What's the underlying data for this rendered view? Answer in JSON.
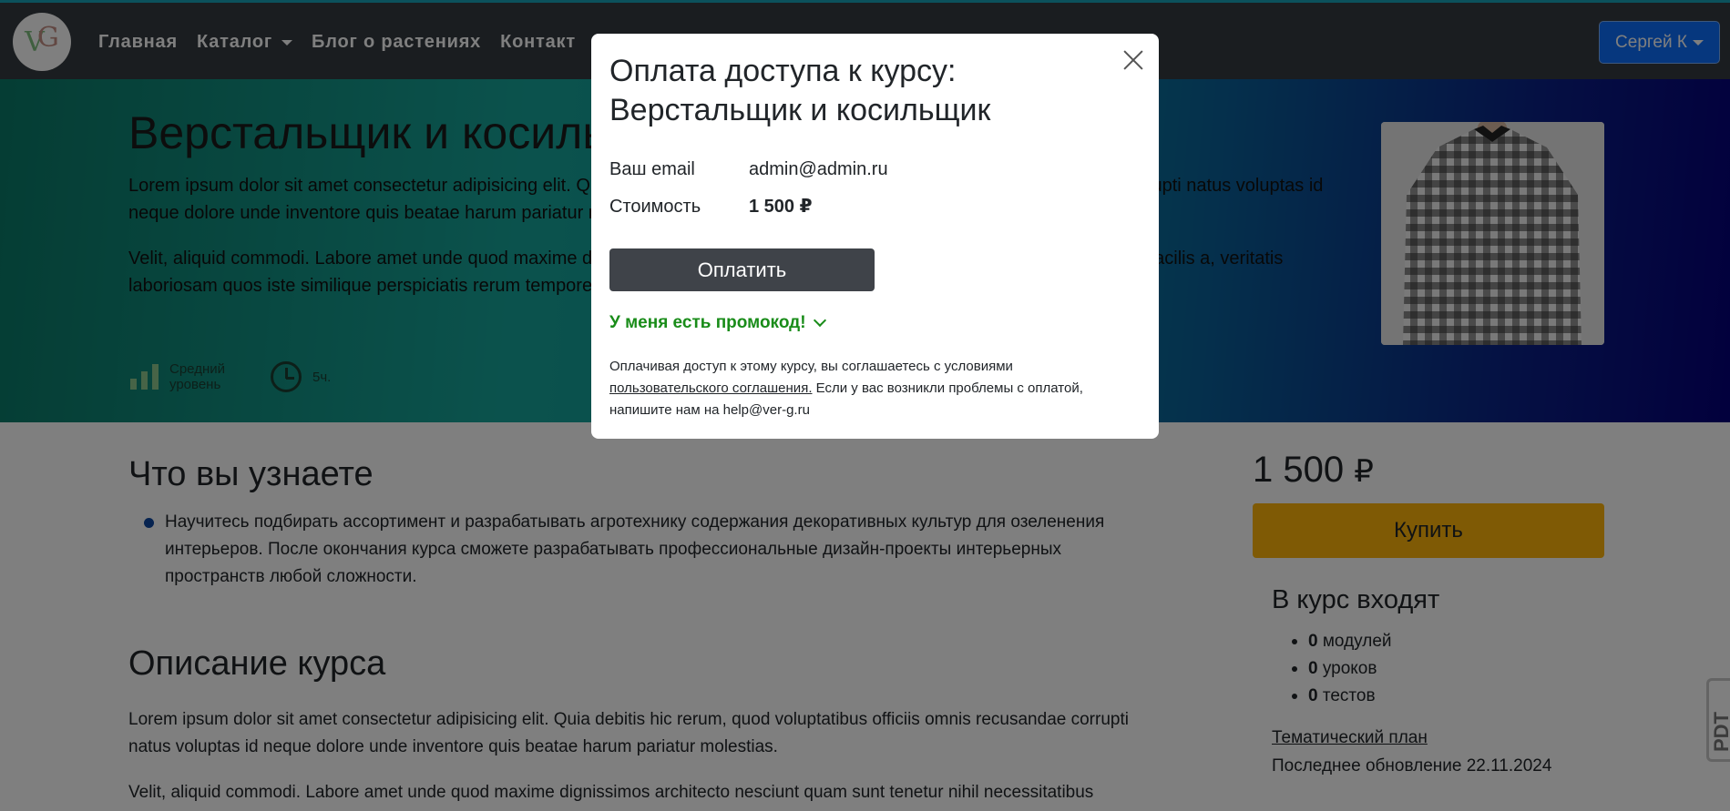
{
  "navbar": {
    "logo_text_v": "V",
    "logo_text_g": "G",
    "links": [
      "Главная",
      "Каталог",
      "Блог о растениях",
      "Контакт"
    ],
    "user": "Сергей К",
    "accent_color": "#17a2b8",
    "user_button_color": "#0d6efd"
  },
  "hero": {
    "title": "Верстальщик и косильщик",
    "p1": "Lorem ipsum dolor sit amet consectetur adipisicing elit. Quia debitis hic rerum, quod voluptatibus officiis omnis recusandae corrupti natus voluptas id neque dolore unde inventore quis beatae harum pariatur molestias.",
    "p2": "Velit, aliquid commodi. Labore amet unde quod maxime dignissimos architecto nesciunt quam sunt tenetur nihil necessitatibus facilis a, veritatis laboriosam quos iste similique perspiciatis rerum tempore.",
    "level_label_1": "Средний",
    "level_label_2": "уровень",
    "duration": "5ч.",
    "level_icon": "level-bars-icon",
    "clock_icon": "clock-icon"
  },
  "learn": {
    "title": "Что вы узнаете",
    "item": "Научитесь подбирать ассортимент и разрабатывать агротехнику содержания декоративных культур для озеленения интерьеров. После окончания курса сможете разрабатывать профессиональные дизайн-проекты интерьерных пространств любой сложности."
  },
  "description": {
    "title": "Описание курса",
    "p1": "Lorem ipsum dolor sit amet consectetur adipisicing elit. Quia debitis hic rerum, quod voluptatibus officiis omnis recusandae corrupti natus voluptas id neque dolore unde inventore quis beatae harum pariatur molestias.",
    "p2": "Velit, aliquid commodi. Labore amet unde quod maxime dignissimos architecto nesciunt quam sunt tenetur nihil necessitatibus"
  },
  "sidebar": {
    "price": "1 500",
    "currency": "₽",
    "buy": "Купить",
    "buy_color": "#ffb50a",
    "includes_title": "В курс входят",
    "includes": [
      {
        "count": "0",
        "label": "модулей"
      },
      {
        "count": "0",
        "label": "уроков"
      },
      {
        "count": "0",
        "label": "тестов"
      }
    ],
    "plan_link": "Тематический план",
    "updated": "Последнее обновление 22.11.2024"
  },
  "side_tab": "PDT",
  "modal": {
    "title": "Оплата доступа к курсу: Верстальщик и косильщик",
    "email_label": "Ваш email",
    "email_value": "admin@admin.ru",
    "cost_label": "Стоимость",
    "cost_value": "1 500",
    "cost_currency": "₽",
    "pay_button": "Оплатить",
    "promo": "У меня есть промокод!",
    "terms_1": "Оплачивая доступ к этому курсу, вы соглашаетесь с условиями",
    "terms_link": "пользовательского соглашения.",
    "terms_2": "Если у вас возникли проблемы с оплатой, напишите нам на help@ver-g.ru",
    "close_icon": "close-icon"
  }
}
